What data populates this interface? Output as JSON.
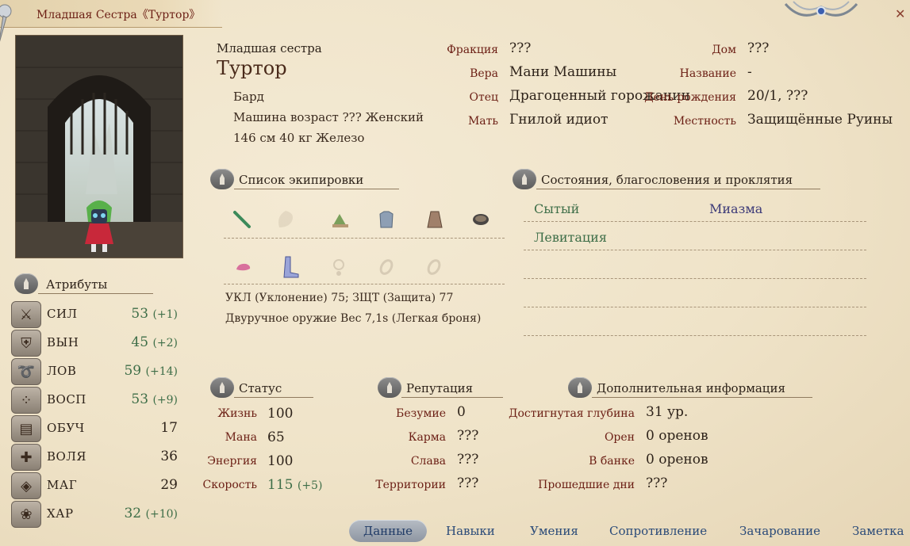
{
  "window": {
    "title": "Младшая Сестра《Туртор》"
  },
  "character": {
    "epithet": "Младшая сестра",
    "name": "Туртор",
    "class": "Бард",
    "line2": "Машина возраст ??? Женский",
    "line3": "146 см 40 кг Железо"
  },
  "info": {
    "faction": {
      "label": "Фракция",
      "value": "???"
    },
    "faith": {
      "label": "Вера",
      "value": "Мани Машины"
    },
    "father": {
      "label": "Отец",
      "value": "Драгоценный горожанин"
    },
    "mother": {
      "label": "Мать",
      "value": "Гнилой идиот"
    },
    "house": {
      "label": "Дом",
      "value": "???"
    },
    "alias": {
      "label": "Название",
      "value": "-"
    },
    "birthday": {
      "label": "День рождения",
      "value": "20/1, ???"
    },
    "locale": {
      "label": "Местность",
      "value": "Защищённые Руины"
    }
  },
  "attributes": {
    "header": "Атрибуты",
    "items": [
      {
        "icon": "crossed-swords-icon",
        "name": "СИЛ",
        "value": "53",
        "bonus": "(+1)"
      },
      {
        "icon": "armor-icon",
        "name": "ВЫН",
        "value": "45",
        "bonus": "(+2)"
      },
      {
        "icon": "dexterity-icon",
        "name": "ЛОВ",
        "value": "59",
        "bonus": "(+14)"
      },
      {
        "icon": "perception-icon",
        "name": "ВОСП",
        "value": "53",
        "bonus": "(+9)"
      },
      {
        "icon": "book-icon",
        "name": "ОБУЧ",
        "value": "17",
        "bonus": ""
      },
      {
        "icon": "shield-icon",
        "name": "ВОЛЯ",
        "value": "36",
        "bonus": ""
      },
      {
        "icon": "magic-rune-icon",
        "name": "МАГ",
        "value": "29",
        "bonus": ""
      },
      {
        "icon": "charisma-bow-icon",
        "name": "ХАР",
        "value": "32",
        "bonus": "(+10)"
      }
    ]
  },
  "equipment": {
    "header": "Список экипировки",
    "line1": "УКЛ (Уклонение) 75; ЗЩТ (Защита) 77",
    "line2": "Двуручное оружие Вес 7,1s (Легкая броня)"
  },
  "conditions": {
    "header": "Состояния, благословения и проклятия",
    "items": [
      "Сытый",
      "Миазма",
      "Левитация"
    ]
  },
  "status": {
    "header": "Статус",
    "life": {
      "label": "Жизнь",
      "value": "100"
    },
    "mana": {
      "label": "Мана",
      "value": "65"
    },
    "energy": {
      "label": "Энергия",
      "value": "100"
    },
    "speed": {
      "label": "Скорость",
      "value": "115",
      "bonus": "(+5)"
    }
  },
  "reputation": {
    "header": "Репутация",
    "madness": {
      "label": "Безумие",
      "value": "0"
    },
    "karma": {
      "label": "Карма",
      "value": "???"
    },
    "fame": {
      "label": "Слава",
      "value": "???"
    },
    "territory": {
      "label": "Территории",
      "value": "???"
    }
  },
  "extra": {
    "header": "Дополнительная информация",
    "depth": {
      "label": "Достигнутая глубина",
      "value": "31 ур."
    },
    "orens": {
      "label": "Орен",
      "value": "0  оренов"
    },
    "bank": {
      "label": "В банке",
      "value": "0  оренов"
    },
    "days": {
      "label": "Прошедшие дни",
      "value": "???"
    }
  },
  "tabs": [
    "Данные",
    "Навыки",
    "Умения",
    "Сопротивление",
    "Зачарование",
    "Заметка"
  ],
  "colors": {
    "accent_label": "#6b1e14",
    "positive": "#3e6e48",
    "negative_condition": "#3c3a78",
    "tab_text": "#2a4a78"
  }
}
